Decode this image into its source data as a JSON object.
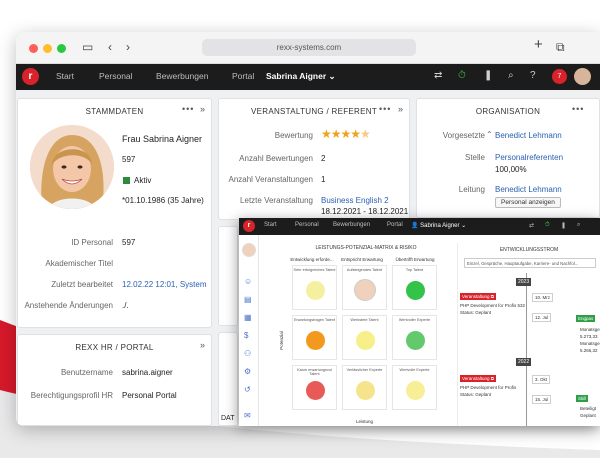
{
  "browser": {
    "url": "rexx-systems.com"
  },
  "nav": {
    "items": [
      "Start",
      "Personal",
      "Bewerbungen",
      "Portal"
    ],
    "user": "Sabrina Aigner",
    "notification_count": "7"
  },
  "stammdaten": {
    "title": "STAMMDATEN",
    "name": "Frau Sabrina Aigner",
    "number": "597",
    "status": "Aktiv",
    "birth": "*01.10.1986 (35 Jahre)",
    "fields": [
      {
        "label": "ID Personal",
        "value": "597",
        "link": false
      },
      {
        "label": "Akademischer Titel",
        "value": "",
        "link": false
      },
      {
        "label": "Zuletzt bearbeitet",
        "value": "12.02.22 12:01, System",
        "link": true
      },
      {
        "label": "Anstehende Änderungen",
        "value": "./.",
        "link": false
      }
    ]
  },
  "veranstaltung": {
    "title": "VERANSTALTUNG / REFERENT",
    "rating_label": "Bewertung",
    "rating": 4.5,
    "fields": [
      {
        "label": "Anzahl Bewertungen",
        "value": "2"
      },
      {
        "label": "Anzahl Veranstaltungen",
        "value": "1"
      },
      {
        "label": "Letzte Veranstaltung",
        "value": "Business English 2",
        "value2": "18.12.2021 - 18.12.2021"
      }
    ]
  },
  "organisation": {
    "title": "ORGANISATION",
    "vorgesetzte_label": "Vorgesetzte",
    "vorgesetzte": "Benedict Lehmann",
    "stelle_label": "Stelle",
    "stelle": "Personalreferenten",
    "stelle_pct": "100,00%",
    "leitung_label": "Leitung",
    "leitung": "Benedict Lehmann",
    "button": "Personal anzeigen"
  },
  "portal": {
    "title": "REXX HR / PORTAL",
    "fields": [
      {
        "label": "Benutzername",
        "value": "sabrina.aigner"
      },
      {
        "label": "Berechtigungsprofil HR",
        "value": "Personal Portal"
      }
    ]
  },
  "partial": {
    "dat_label": "DAT"
  },
  "inner": {
    "nav_items": [
      "Start",
      "Personal",
      "Bewerbungen",
      "Portal"
    ],
    "user": "Sabrina Aigner",
    "matrix_title": "LEISTUNGS-POTENZIAL-MATRIX & RISIKO",
    "col_heads": [
      "Entwicklung erforde...",
      "Entspricht Erwartung",
      "Übertrifft Erwartung"
    ],
    "cell_labels": [
      "Sehr erfolgreiches Talent",
      "Aufsteigendes Talent",
      "Top Talent",
      "Erwartungstragen Talent",
      "Werkstete Talent",
      "Wertvoller Experte",
      "Kaum erwartungsvol Talent",
      "Verlässlicher Experte",
      "Wertvolle Experte"
    ],
    "y_axis": "Potenzial",
    "x_axis": "Leistung",
    "colors": [
      "#f5f0a0",
      "#ffffff",
      "#33c24a",
      "#f39a1e",
      "#f6ef8a",
      "#63c96c",
      "#e85a57",
      "#f6e48c",
      "#f7ee96"
    ],
    "timeline_title": "ENTWICKLUNGSSTROM",
    "filter": "Einzel, Gespräche, Hauptaufgabe, Karriere- und Nachfol...",
    "years": [
      "2023",
      "2022"
    ],
    "events": [
      {
        "tag": "Veranstaltung",
        "title": "PHP Development for Profis 532",
        "status": "Status: Geplant",
        "date": "10. Mrz",
        "date2": "12. Jul"
      },
      {
        "tag": "Veranstaltung",
        "title": "PHP Development for Profis",
        "status": "Status: Geplant",
        "date": "3. Okt",
        "date2": "15. Jul"
      }
    ],
    "right_tags": [
      "Engpas",
      "Monatsge",
      "5.273,33",
      "Monatsge",
      "5.266,32",
      "Skill",
      "Beteiligt",
      "Geplant"
    ]
  }
}
